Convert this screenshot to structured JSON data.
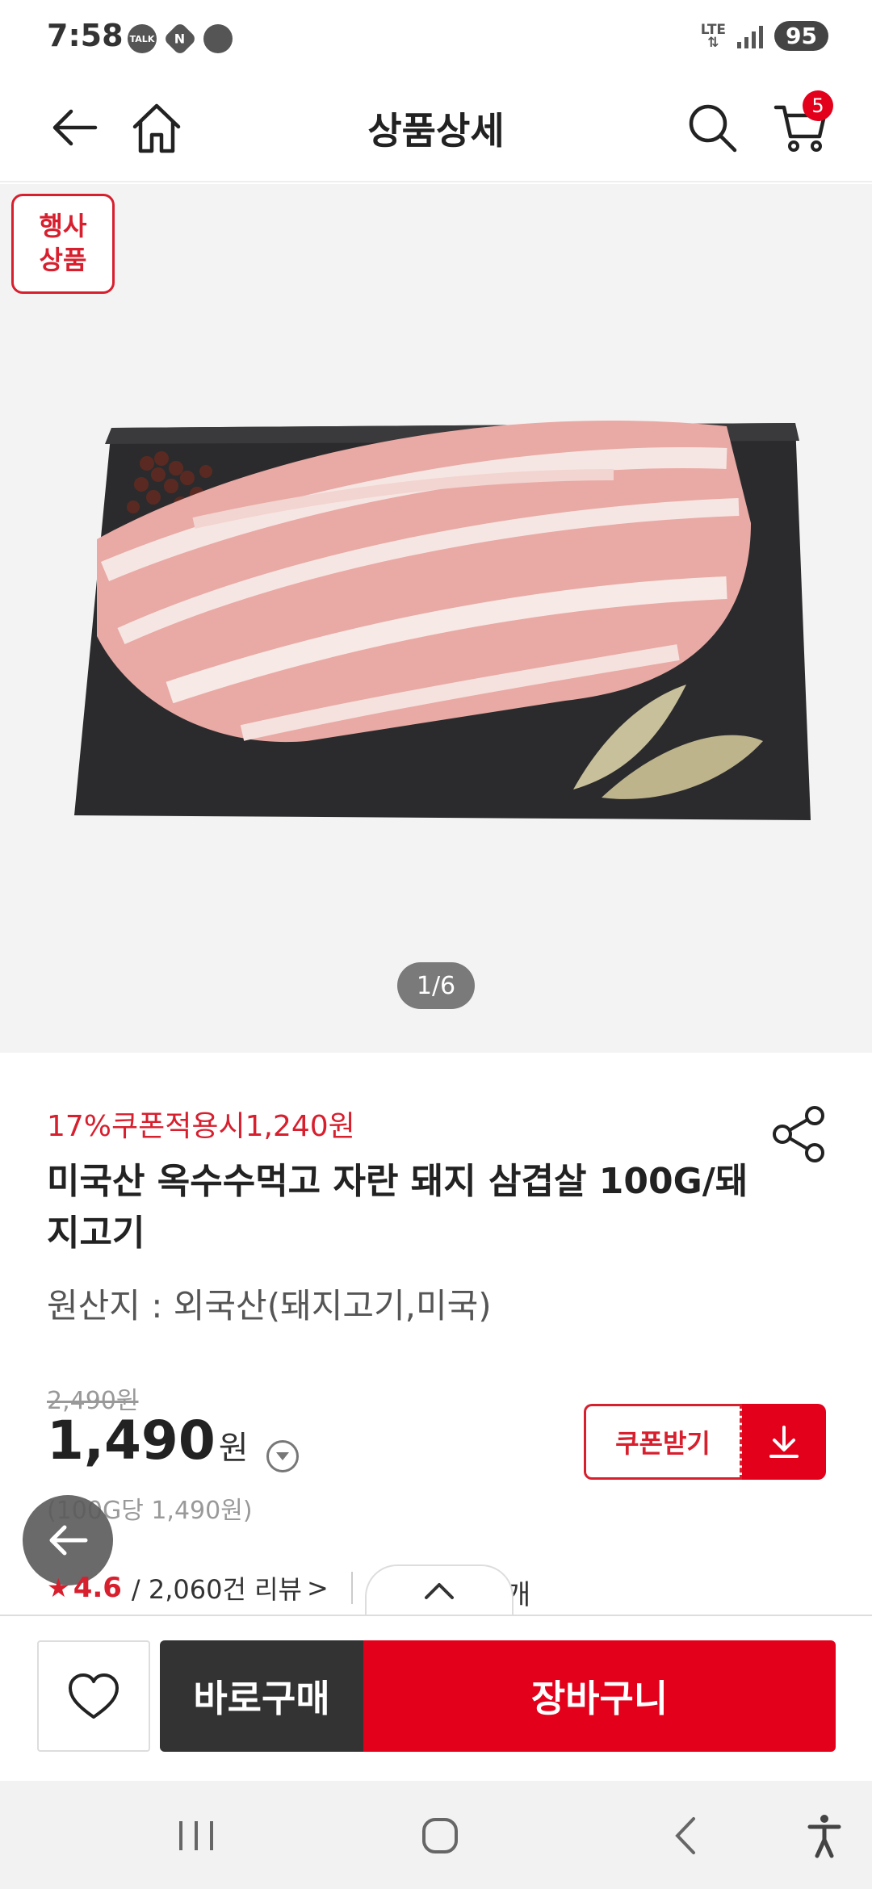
{
  "status_bar": {
    "time": "7:58",
    "notif_icons": [
      "talk-icon",
      "naver-icon",
      "chat-bubble-icon"
    ],
    "talk_label": "TALK",
    "n_label": "N",
    "network": "LTE",
    "battery": "95"
  },
  "header": {
    "title": "상품상세",
    "cart_count": "5"
  },
  "gallery": {
    "event_badge": "행사\n상품",
    "event_badge_line1": "행사",
    "event_badge_line2": "상품",
    "page_indicator": "1/6"
  },
  "product": {
    "coupon_price_text": "17%쿠폰적용시1,240원",
    "name": "미국산 옥수수먹고 자란 돼지 삼겹살 100G/돼지고기",
    "origin": "원산지 : 외국산(돼지고기,미국)",
    "original_price": "2,490원",
    "price": "1,490",
    "price_unit": "원",
    "unit_price": "(100G당 1,490원)",
    "coupon_button": "쿠폰받기",
    "rating": "4.6",
    "review_text": "/ 2,060건 리뷰",
    "review_chevron": ">",
    "stock_suffix": "개"
  },
  "buy_bar": {
    "buy_now": "바로구매",
    "add_to_cart": "장바구니"
  },
  "colors": {
    "accent": "#e3001b",
    "dark": "#333333"
  }
}
